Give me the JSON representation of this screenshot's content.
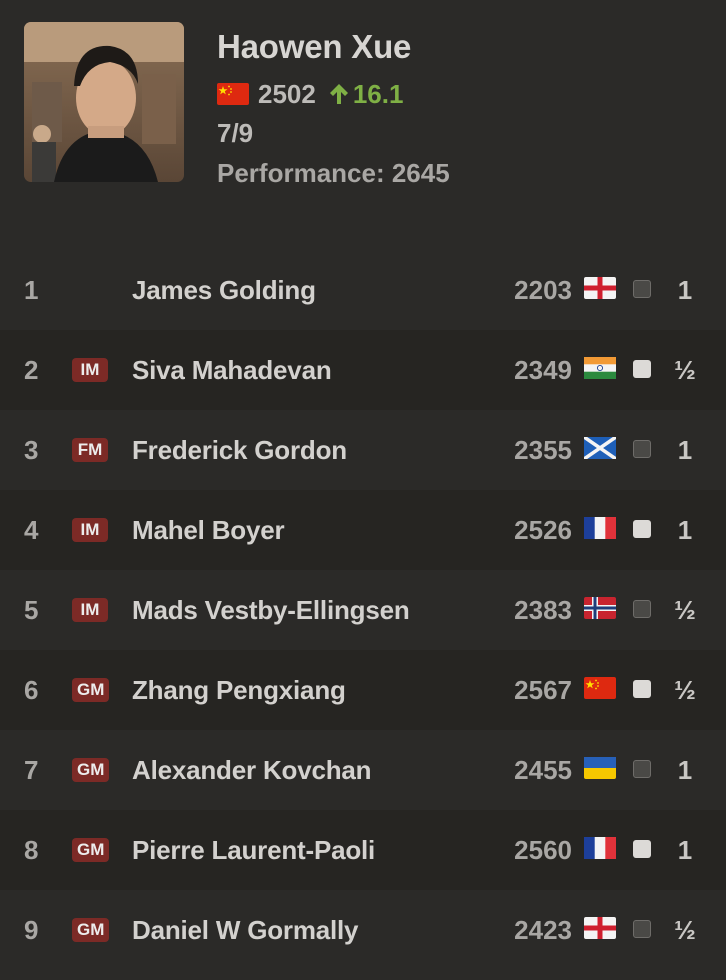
{
  "player": {
    "name": "Haowen Xue",
    "federation_flag": "china-flag-icon",
    "rating": "2502",
    "rating_change": "16.1",
    "rating_change_color": "#7fb045",
    "score": "7/9",
    "performance": "Performance: 2645"
  },
  "games": [
    {
      "round": "1",
      "title": "",
      "name": "James Golding",
      "rating": "2203",
      "flag": "england-flag-icon",
      "color": "black",
      "result": "1"
    },
    {
      "round": "2",
      "title": "IM",
      "name": "Siva Mahadevan",
      "rating": "2349",
      "flag": "india-flag-icon",
      "color": "white",
      "result": "½"
    },
    {
      "round": "3",
      "title": "FM",
      "name": "Frederick Gordon",
      "rating": "2355",
      "flag": "scotland-flag-icon",
      "color": "black",
      "result": "1"
    },
    {
      "round": "4",
      "title": "IM",
      "name": "Mahel Boyer",
      "rating": "2526",
      "flag": "france-flag-icon",
      "color": "white",
      "result": "1"
    },
    {
      "round": "5",
      "title": "IM",
      "name": "Mads Vestby-Ellingsen",
      "rating": "2383",
      "flag": "norway-flag-icon",
      "color": "black",
      "result": "½"
    },
    {
      "round": "6",
      "title": "GM",
      "name": "Zhang Pengxiang",
      "rating": "2567",
      "flag": "china-flag-icon",
      "color": "white",
      "result": "½"
    },
    {
      "round": "7",
      "title": "GM",
      "name": "Alexander Kovchan",
      "rating": "2455",
      "flag": "ukraine-flag-icon",
      "color": "black",
      "result": "1"
    },
    {
      "round": "8",
      "title": "GM",
      "name": "Pierre Laurent-Paoli",
      "rating": "2560",
      "flag": "france-flag-icon",
      "color": "white",
      "result": "1"
    },
    {
      "round": "9",
      "title": "GM",
      "name": "Daniel W Gormally",
      "rating": "2423",
      "flag": "england-flag-icon",
      "color": "black",
      "result": "½"
    }
  ]
}
